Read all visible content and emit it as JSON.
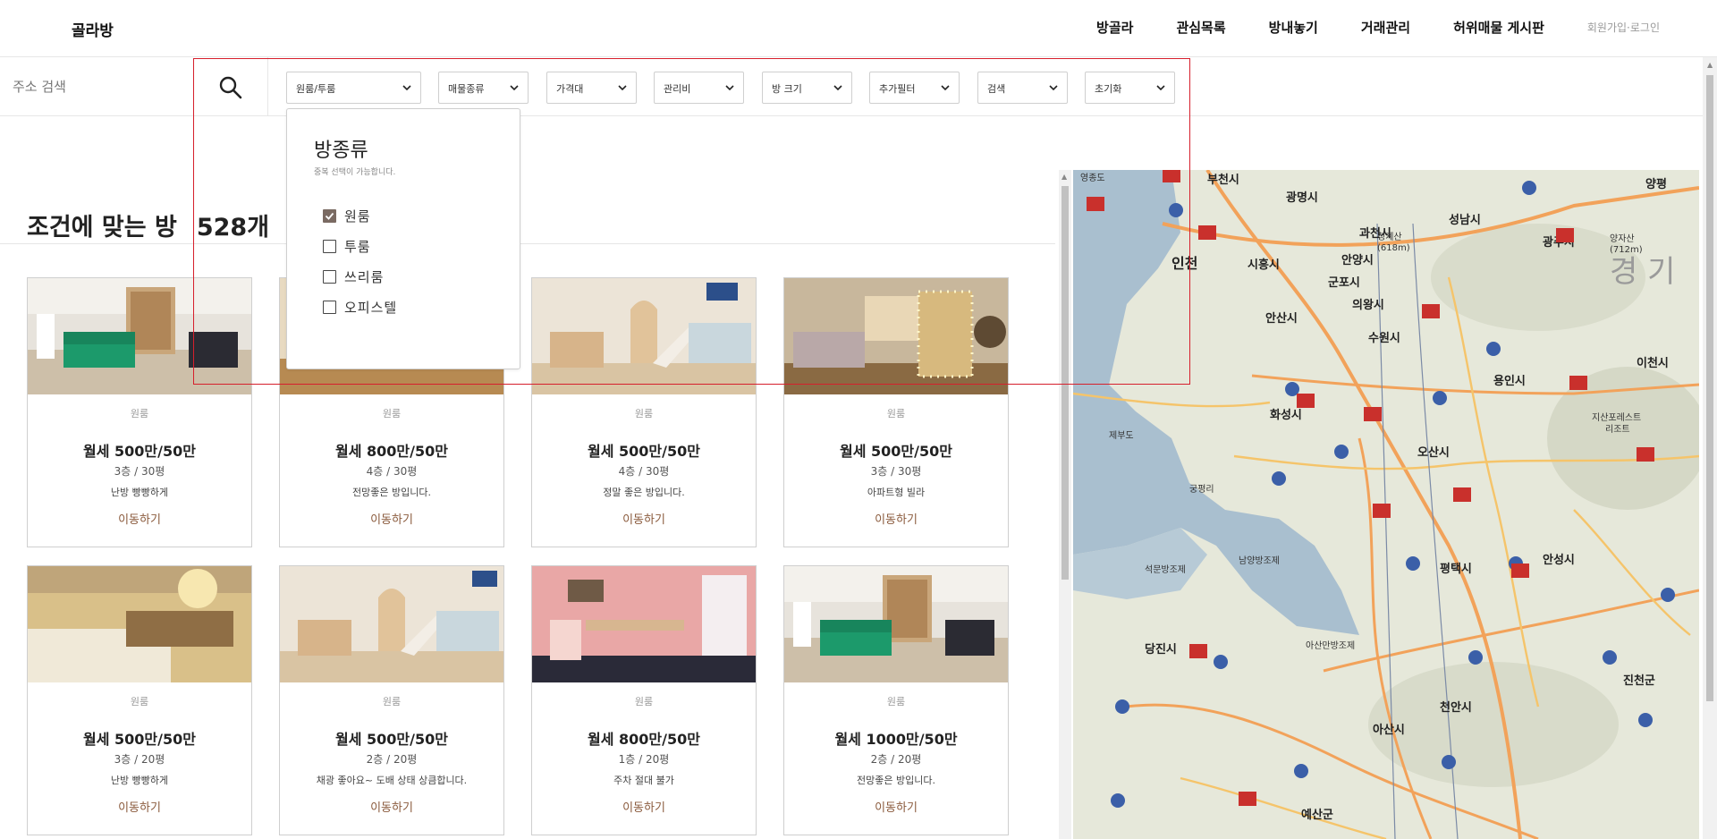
{
  "app": {
    "logo": "골라방"
  },
  "nav": {
    "items": [
      "방골라",
      "관심목록",
      "방내놓기",
      "거래관리",
      "허위매물 게시판"
    ],
    "auth": "회원가입·로그인"
  },
  "search": {
    "placeholder": "주소 검색",
    "icon": "search-icon"
  },
  "filters": [
    {
      "label": "원룸/투룸"
    },
    {
      "label": "매물종류"
    },
    {
      "label": "가격대"
    },
    {
      "label": "관리비"
    },
    {
      "label": "방 크기"
    },
    {
      "label": "추가필터"
    },
    {
      "label": "검색"
    },
    {
      "label": "초기화"
    }
  ],
  "popup": {
    "title": "방종류",
    "subtitle": "중복 선택이 가능합니다.",
    "options": [
      {
        "label": "원룸",
        "checked": true
      },
      {
        "label": "투룸",
        "checked": false
      },
      {
        "label": "쓰리룸",
        "checked": false
      },
      {
        "label": "오피스텔",
        "checked": false
      }
    ]
  },
  "results": {
    "title": "조건에 맞는 방",
    "count": "528개"
  },
  "listings": [
    {
      "type": "원룸",
      "price": "월세 500만/50만",
      "floor": "3층 / 30평",
      "desc": "난방 빵빵하게",
      "action": "이동하기"
    },
    {
      "type": "원룸",
      "price": "월세 800만/50만",
      "floor": "4층 / 30평",
      "desc": "전망좋은 방입니다.",
      "action": "이동하기"
    },
    {
      "type": "원룸",
      "price": "월세 500만/50만",
      "floor": "4층 / 30평",
      "desc": "정말 좋은 방입니다.",
      "action": "이동하기"
    },
    {
      "type": "원룸",
      "price": "월세 500만/50만",
      "floor": "3층 / 30평",
      "desc": "아파트형 빌라",
      "action": "이동하기"
    },
    {
      "type": "원룸",
      "price": "월세 500만/50만",
      "floor": "3층 / 20평",
      "desc": "난방 빵빵하게",
      "action": "이동하기"
    },
    {
      "type": "원룸",
      "price": "월세 500만/50만",
      "floor": "2층 / 20평",
      "desc": "채광 좋아요~ 도배 상태 상큼합니다.",
      "action": "이동하기"
    },
    {
      "type": "원룸",
      "price": "월세 800만/50만",
      "floor": "1층 / 20평",
      "desc": "주차 절대 불가",
      "action": "이동하기"
    },
    {
      "type": "원룸",
      "price": "월세 1000만/50만",
      "floor": "2층 / 20평",
      "desc": "전망좋은 방입니다.",
      "action": "이동하기"
    }
  ],
  "map": {
    "labels": [
      "영종도",
      "부천시",
      "광명시",
      "시흥시",
      "과천시",
      "성남시",
      "광주시",
      "인천",
      "안양시",
      "군포시",
      "의왕시",
      "안산시",
      "수원시",
      "용인시",
      "이천시",
      "화성시",
      "오산시",
      "제부도",
      "지산포레스트 리조트",
      "궁평리",
      "평택시",
      "안성시",
      "석문방조제",
      "남양방조제",
      "당진시",
      "아산만방조제",
      "진천군",
      "아산시",
      "천안시",
      "예산군",
      "경 기",
      "양평",
      "양자산 (712m)",
      "청계산 (618m)"
    ]
  },
  "colors": {
    "accent": "#d61f2c",
    "link": "#8a5a3c",
    "checkbox": "#7a6a62"
  }
}
